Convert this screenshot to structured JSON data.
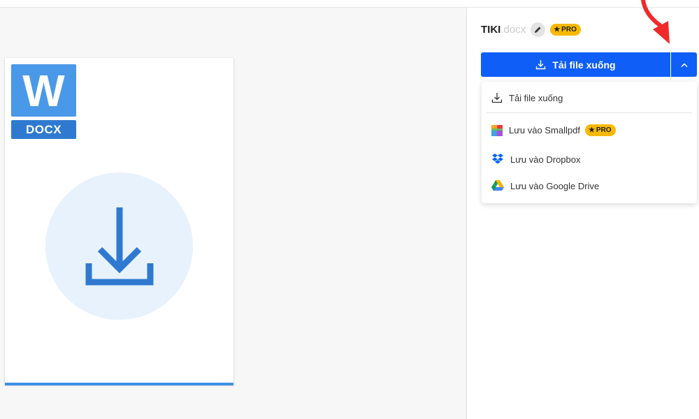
{
  "file": {
    "name": "TIKI",
    "extension": ".docx",
    "type_tag": "DOCX",
    "type_letter": "W"
  },
  "pro_badge": {
    "label": "PRO",
    "color": "#f7b900"
  },
  "actions": {
    "download_label": "Tải file xuống",
    "primary_color": "#0f5ef7"
  },
  "dropdown": {
    "items": [
      {
        "label": "Tải file xuống",
        "icon": "download-icon"
      },
      {
        "label": "Lưu vào Smallpdf",
        "icon": "smallpdf-icon",
        "pro": true
      },
      {
        "label": "Lưu vào Dropbox",
        "icon": "dropbox-icon"
      },
      {
        "label": "Lưu vào Google Drive",
        "icon": "google-drive-icon"
      }
    ]
  },
  "annotation": {
    "icon": "red-arrow-icon",
    "color": "#f02a2a"
  }
}
